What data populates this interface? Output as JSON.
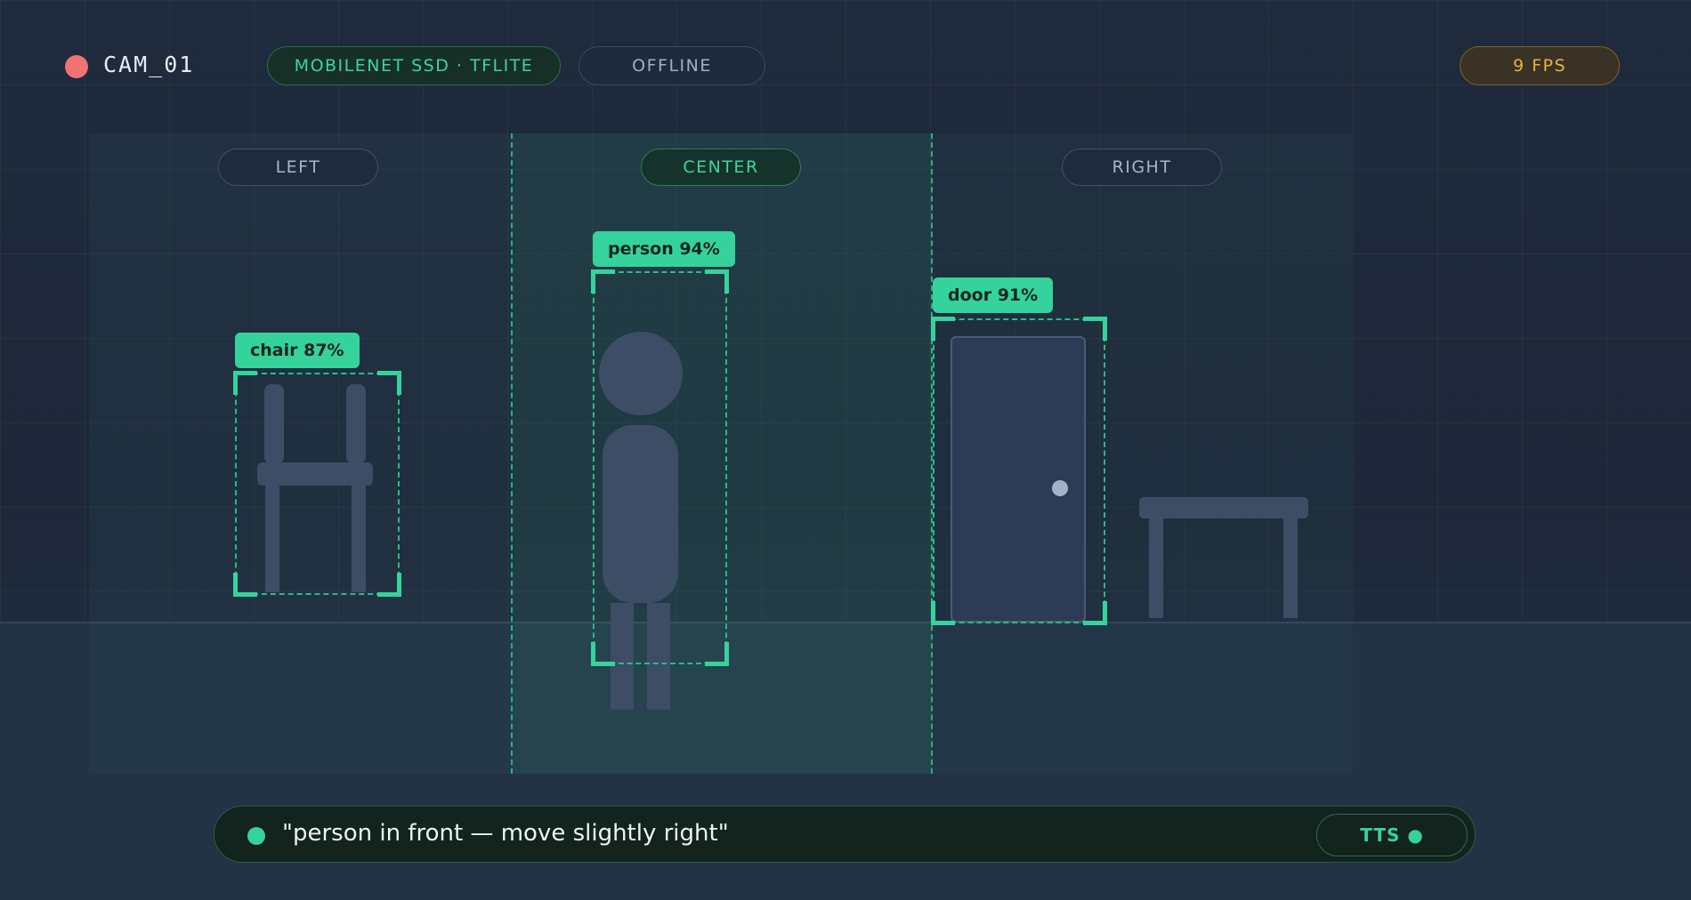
{
  "header": {
    "camera_label": "CAM_01",
    "model_label": "MOBILENET SSD · TFLITE",
    "status_label": "OFFLINE",
    "fps_label": "9 FPS"
  },
  "zones": [
    {
      "label": "LEFT",
      "active": false
    },
    {
      "label": "CENTER",
      "active": true
    },
    {
      "label": "RIGHT",
      "active": false
    }
  ],
  "detections": [
    {
      "label": "chair 87%",
      "class": "chair",
      "confidence": 87,
      "zone": "LEFT"
    },
    {
      "label": "person 94%",
      "class": "person",
      "confidence": 94,
      "zone": "CENTER"
    },
    {
      "label": "door 91%",
      "class": "door",
      "confidence": 91,
      "zone": "RIGHT"
    }
  ],
  "speech": {
    "text": "\"person in front — move slightly right\"",
    "tts_label": "TTS ●"
  },
  "colors": {
    "accent": "#35d39b",
    "record": "#f07272",
    "fps": "#e6b33a",
    "object": "#3d4d66"
  }
}
